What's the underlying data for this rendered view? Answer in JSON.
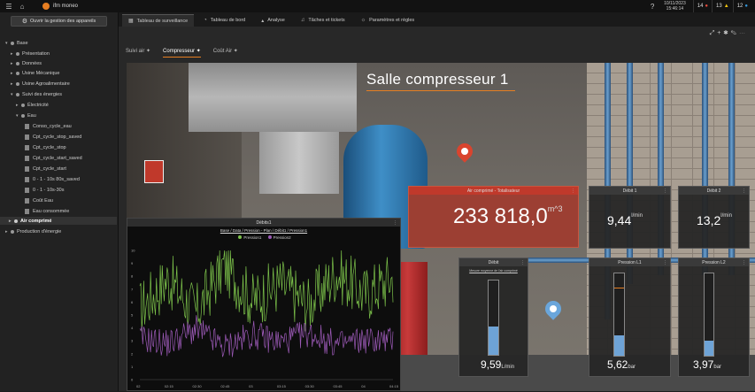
{
  "topbar": {
    "app_name": "ifm moneo",
    "date": "10/11/2023",
    "time": "15:46:14",
    "badge_red": "14",
    "badge_orange": "13",
    "badge_blue": "12"
  },
  "sidebar": {
    "manage_button": "Ouvrir la gestion des appareils",
    "items": [
      {
        "label": "Base"
      },
      {
        "label": "Présentation"
      },
      {
        "label": "Données"
      },
      {
        "label": "Usine Mécanique"
      },
      {
        "label": "Usine Agroalimentaire"
      },
      {
        "label": "Suivi des énergies"
      },
      {
        "label": "Électricité"
      },
      {
        "label": "Eau"
      },
      {
        "label": "Conso_cycle_eau"
      },
      {
        "label": "Cpt_cycle_stop_saved"
      },
      {
        "label": "Cpt_cycle_stop"
      },
      {
        "label": "Cpt_cycle_start_saved"
      },
      {
        "label": "Cpt_cycle_start"
      },
      {
        "label": "0 - 1 - 10s 80s_saved"
      },
      {
        "label": "0 - 1 - 10s-30s"
      },
      {
        "label": "Coût Eau"
      },
      {
        "label": "Eau consommée"
      },
      {
        "label": "Air comprimé"
      },
      {
        "label": "Production d'énergie"
      }
    ]
  },
  "tabs": [
    {
      "label": "Tableau de surveillance"
    },
    {
      "label": "Tableau de bord"
    },
    {
      "label": "Analyse"
    },
    {
      "label": "Tâches et tickets"
    },
    {
      "label": "Paramètres et règles"
    }
  ],
  "subtabs": [
    {
      "label": "Suivi air"
    },
    {
      "label": "Compresseur"
    },
    {
      "label": "Coût Air"
    }
  ],
  "scene": {
    "title": "Salle compresseur 1"
  },
  "widgets": {
    "total": {
      "title": "Air comprimé - Totalisateur",
      "value": "233 818,0",
      "unit": "m^3"
    },
    "debit1": {
      "title": "Débit 1",
      "value": "9,44",
      "unit": "l/min"
    },
    "debit2": {
      "title": "Débit 2",
      "value": "13,2",
      "unit": "l/min"
    },
    "debit": {
      "title": "Débit",
      "subtitle": "Mesure moyenne de l'air comprimé",
      "value": "9,59",
      "unit": "L/min",
      "fill": 0.38
    },
    "pression1": {
      "title": "Pression L1",
      "value": "5,62",
      "unit": "bar",
      "fill": 0.25,
      "marker": 0.82
    },
    "pression2": {
      "title": "Pression L2",
      "value": "3,97",
      "unit": "bar",
      "fill": 0.18
    }
  },
  "chart_widget": {
    "title": "Débits1",
    "chart_data": {
      "type": "line",
      "title": "Base / Data / Pression - Plan / Débit1 / Pression1",
      "series": [
        {
          "name": "Pression1",
          "color": "#7cc24a"
        },
        {
          "name": "Pression2",
          "color": "#9b59b6"
        }
      ],
      "ylim": [
        0,
        10
      ],
      "yticks": [
        "10",
        "9",
        "8",
        "7",
        "6",
        "5",
        "4",
        "3",
        "2",
        "1",
        "0"
      ],
      "xticks": [
        "02",
        "02:15",
        "02:30",
        "02:45",
        "03",
        "03:15",
        "03:30",
        "03:45",
        "04",
        "04:15"
      ],
      "x": [
        "02",
        "02:15",
        "02:30",
        "02:45",
        "03",
        "03:15",
        "03:30",
        "03:45",
        "04",
        "04:15"
      ],
      "pression1_values": [
        5.5,
        7.8,
        5.2,
        8.9,
        6.1,
        7.4,
        5.8,
        8.3,
        6.6,
        7.9
      ],
      "pression2_values": [
        3.2,
        2.8,
        3.9,
        2.5,
        3.5,
        2.9,
        3.6,
        2.7,
        3.1,
        3.0
      ]
    }
  }
}
